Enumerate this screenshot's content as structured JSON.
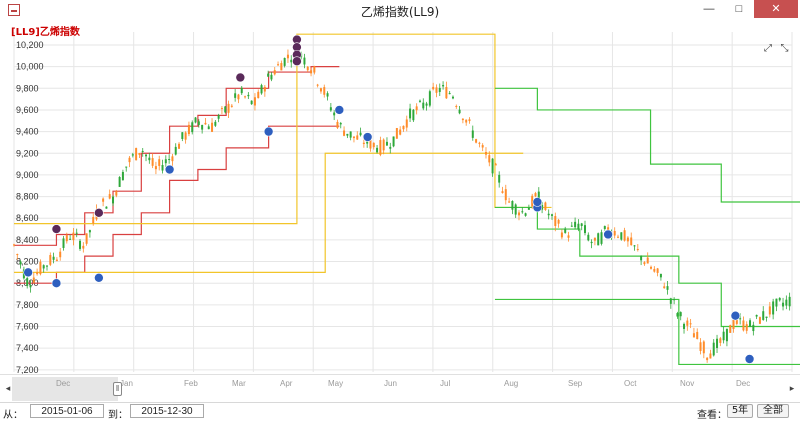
{
  "window": {
    "title": "乙烯指数(LL9)",
    "min_label": "—",
    "max_label": "□",
    "close_label": "✕"
  },
  "chart_title": "[LL9]乙烯指数",
  "toolbar": {
    "expand_icon": "⤢",
    "link_icon": "⤡"
  },
  "colors": {
    "up": "#ff8c2a",
    "down": "#2ea83a",
    "line_red": "#d94040",
    "line_red_light": "#e88080",
    "line_yellow": "#f2c52a",
    "line_green": "#3fc43f",
    "line_green_light": "#7edb7e",
    "marker_high": "#5a2a5a",
    "marker_low": "#2e5fbf",
    "grid": "#e6e6e6"
  },
  "chart_data": {
    "type": "line",
    "y_ticks": [
      "10,200",
      "10,000",
      "9,800",
      "9,600",
      "9,400",
      "9,200",
      "9,000",
      "8,800",
      "8,600",
      "8,400",
      "8,200",
      "8,000",
      "7,800",
      "7,600",
      "7,400",
      "7,200"
    ],
    "y_tick_values": [
      10200,
      10000,
      9800,
      9600,
      9400,
      9200,
      9000,
      8800,
      8600,
      8400,
      8200,
      8000,
      7800,
      7600,
      7400,
      7200
    ],
    "ylim": [
      7180,
      10320
    ],
    "x_range": [
      "2015-01-06",
      "2015-12-30"
    ],
    "price_path": [
      [
        0,
        8350
      ],
      [
        6,
        8000
      ],
      [
        12,
        8150
      ],
      [
        18,
        8250
      ],
      [
        24,
        8450
      ],
      [
        30,
        8350
      ],
      [
        36,
        8700
      ],
      [
        42,
        8800
      ],
      [
        48,
        9100
      ],
      [
        54,
        9250
      ],
      [
        60,
        9050
      ],
      [
        66,
        9150
      ],
      [
        72,
        9350
      ],
      [
        78,
        9500
      ],
      [
        84,
        9450
      ],
      [
        90,
        9600
      ],
      [
        96,
        9750
      ],
      [
        102,
        9650
      ],
      [
        108,
        9900
      ],
      [
        114,
        10050
      ],
      [
        120,
        10150
      ],
      [
        126,
        10000
      ],
      [
        132,
        9750
      ],
      [
        138,
        9450
      ],
      [
        144,
        9350
      ],
      [
        150,
        9300
      ],
      [
        156,
        9250
      ],
      [
        162,
        9350
      ],
      [
        168,
        9550
      ],
      [
        174,
        9650
      ],
      [
        180,
        9800
      ],
      [
        186,
        9750
      ],
      [
        192,
        9500
      ],
      [
        198,
        9250
      ],
      [
        204,
        9050
      ],
      [
        210,
        8750
      ],
      [
        216,
        8650
      ],
      [
        222,
        8800
      ],
      [
        228,
        8600
      ],
      [
        234,
        8450
      ],
      [
        240,
        8550
      ],
      [
        246,
        8350
      ],
      [
        252,
        8500
      ],
      [
        258,
        8450
      ],
      [
        264,
        8300
      ],
      [
        270,
        8150
      ],
      [
        276,
        8000
      ],
      [
        282,
        7700
      ],
      [
        288,
        7550
      ],
      [
        294,
        7350
      ],
      [
        300,
        7450
      ],
      [
        306,
        7650
      ],
      [
        312,
        7600
      ],
      [
        318,
        7700
      ],
      [
        324,
        7800
      ],
      [
        330,
        7850
      ]
    ],
    "series": [
      {
        "name": "",
        "color": "line_red",
        "steps": [
          [
            0,
            8350
          ],
          [
            18,
            8450
          ],
          [
            30,
            8650
          ],
          [
            42,
            8850
          ],
          [
            54,
            9200
          ],
          [
            66,
            9450
          ],
          [
            78,
            9550
          ],
          [
            90,
            9800
          ],
          [
            108,
            9950
          ],
          [
            126,
            10000
          ]
        ]
      },
      {
        "name": "",
        "color": "line_red",
        "steps": [
          [
            0,
            8000
          ],
          [
            18,
            8100
          ],
          [
            30,
            8250
          ],
          [
            42,
            8450
          ],
          [
            54,
            8650
          ],
          [
            66,
            8950
          ],
          [
            78,
            9050
          ],
          [
            90,
            9250
          ],
          [
            108,
            9450
          ],
          [
            126,
            9450
          ]
        ]
      },
      {
        "name": "",
        "color": "line_yellow",
        "steps": [
          [
            0,
            8550
          ],
          [
            18,
            8550
          ],
          [
            36,
            8550
          ],
          [
            120,
            10300
          ],
          [
            190,
            10300
          ],
          [
            204,
            8700
          ],
          [
            216,
            8700
          ]
        ]
      },
      {
        "name": "",
        "color": "line_yellow",
        "steps": [
          [
            0,
            8100
          ],
          [
            30,
            8100
          ],
          [
            132,
            9200
          ],
          [
            204,
            9200
          ]
        ]
      },
      {
        "name": "",
        "color": "line_green",
        "steps": [
          [
            204,
            9800
          ],
          [
            222,
            9600
          ],
          [
            252,
            9600
          ],
          [
            270,
            9100
          ],
          [
            300,
            8750
          ],
          [
            330,
            8750
          ]
        ]
      },
      {
        "name": "",
        "color": "line_green",
        "steps": [
          [
            204,
            8700
          ],
          [
            222,
            8500
          ],
          [
            240,
            8250
          ],
          [
            282,
            8000
          ],
          [
            300,
            7600
          ],
          [
            318,
            7600
          ],
          [
            330,
            7600
          ]
        ]
      },
      {
        "name": "",
        "color": "line_green",
        "steps": [
          [
            204,
            7850
          ],
          [
            222,
            7850
          ],
          [
            282,
            7250
          ],
          [
            330,
            7250
          ]
        ]
      }
    ],
    "markers_high": [
      [
        120,
        10250
      ],
      [
        120,
        10180
      ],
      [
        120,
        10110
      ],
      [
        120,
        10050
      ],
      [
        96,
        9900
      ],
      [
        36,
        8650
      ],
      [
        18,
        8500
      ]
    ],
    "markers_low": [
      [
        6,
        8100
      ],
      [
        18,
        8000
      ],
      [
        36,
        8050
      ],
      [
        66,
        9050
      ],
      [
        108,
        9400
      ],
      [
        138,
        9600
      ],
      [
        150,
        9350
      ],
      [
        222,
        8700
      ],
      [
        222,
        8750
      ],
      [
        252,
        8450
      ],
      [
        306,
        7700
      ],
      [
        312,
        7300
      ]
    ],
    "grid": true
  },
  "navigator": {
    "ticks": [
      {
        "label": "Dec",
        "pos": 0.07
      },
      {
        "label": "Jan",
        "pos": 0.15
      },
      {
        "label": "Feb",
        "pos": 0.23
      },
      {
        "label": "Mar",
        "pos": 0.29
      },
      {
        "label": "Apr",
        "pos": 0.35
      },
      {
        "label": "May",
        "pos": 0.41
      },
      {
        "label": "Jun",
        "pos": 0.48
      },
      {
        "label": "Jul",
        "pos": 0.55
      },
      {
        "label": "Aug",
        "pos": 0.63
      },
      {
        "label": "Sep",
        "pos": 0.71
      },
      {
        "label": "Oct",
        "pos": 0.78
      },
      {
        "label": "Nov",
        "pos": 0.85
      },
      {
        "label": "Dec",
        "pos": 0.92
      }
    ],
    "left_arrow": "◂",
    "right_arrow": "▸",
    "handle_label": "‖"
  },
  "range": {
    "from_label": "从：",
    "from_value": "2015-01-06",
    "to_label": "到：",
    "to_value": "2015-12-30",
    "view_label": "查看：",
    "btn_5y": "5年",
    "btn_all": "全部"
  }
}
